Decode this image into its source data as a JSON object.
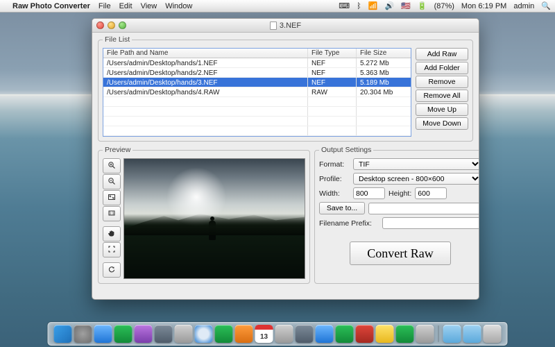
{
  "menubar": {
    "app_name": "Raw Photo Converter",
    "menus": [
      "File",
      "Edit",
      "View",
      "Window"
    ],
    "battery_pct": "(87%)",
    "clock": "Mon 6:19 PM",
    "user": "admin"
  },
  "window": {
    "title": "3.NEF"
  },
  "filelist": {
    "legend": "File List",
    "columns": {
      "path": "File Path and Name",
      "type": "File Type",
      "size": "File Size"
    },
    "rows": [
      {
        "path": "/Users/admin/Desktop/hands/1.NEF",
        "type": "NEF",
        "size": "5.272 Mb",
        "selected": false
      },
      {
        "path": "/Users/admin/Desktop/hands/2.NEF",
        "type": "NEF",
        "size": "5.363 Mb",
        "selected": false
      },
      {
        "path": "/Users/admin/Desktop/hands/3.NEF",
        "type": "NEF",
        "size": "5.189 Mb",
        "selected": true
      },
      {
        "path": "/Users/admin/Desktop/hands/4.RAW",
        "type": "RAW",
        "size": "20.304 Mb",
        "selected": false
      }
    ],
    "buttons": {
      "add_raw": "Add Raw",
      "add_folder": "Add Folder",
      "remove": "Remove",
      "remove_all": "Remove All",
      "move_up": "Move Up",
      "move_down": "Move Down"
    }
  },
  "preview": {
    "legend": "Preview",
    "tools": {
      "zoom_in": "zoom-in-icon",
      "zoom_out": "zoom-out-icon",
      "fit": "fit-to-window-icon",
      "actual": "actual-size-icon",
      "pan": "pan-hand-icon",
      "fullscreen": "fullscreen-icon",
      "reload": "reload-icon"
    }
  },
  "output": {
    "legend": "Output Settings",
    "labels": {
      "format": "Format:",
      "profile": "Profile:",
      "width": "Width:",
      "height": "Height:",
      "save_to": "Save to...",
      "filename_prefix": "Filename Prefix:"
    },
    "values": {
      "format": "TIF",
      "profile": "Desktop screen - 800×600",
      "width": "800",
      "height": "600",
      "save_path": "",
      "filename_prefix": ""
    },
    "convert_label": "Convert Raw"
  },
  "dock": {
    "items": [
      {
        "name": "finder-icon",
        "cls": "finder"
      },
      {
        "name": "launchpad-icon",
        "cls": "launchpad"
      },
      {
        "name": "app-store-icon",
        "cls": "appstore"
      },
      {
        "name": "activity-icon",
        "cls": "green"
      },
      {
        "name": "imovie-icon",
        "cls": "purple"
      },
      {
        "name": "dashboard-icon",
        "cls": "slate"
      },
      {
        "name": "mail-icon",
        "cls": "gray"
      },
      {
        "name": "safari-icon",
        "cls": "safari"
      },
      {
        "name": "facetime-icon",
        "cls": "green"
      },
      {
        "name": "contacts-icon",
        "cls": "orange"
      },
      {
        "name": "calendar-icon",
        "cls": "cal"
      },
      {
        "name": "reminders-icon",
        "cls": "gray"
      },
      {
        "name": "preview-icon",
        "cls": "slate"
      },
      {
        "name": "itunes-icon",
        "cls": "appstore"
      },
      {
        "name": "numbers-icon",
        "cls": "green"
      },
      {
        "name": "photobooth-icon",
        "cls": "red"
      },
      {
        "name": "notes-icon",
        "cls": "yellow"
      },
      {
        "name": "maps-icon",
        "cls": "green"
      },
      {
        "name": "systemprefs-icon",
        "cls": "gray"
      }
    ],
    "right_items": [
      {
        "name": "downloads-folder-icon",
        "cls": "folder"
      },
      {
        "name": "documents-folder-icon",
        "cls": "folder"
      },
      {
        "name": "trash-icon",
        "cls": "trash"
      }
    ]
  }
}
